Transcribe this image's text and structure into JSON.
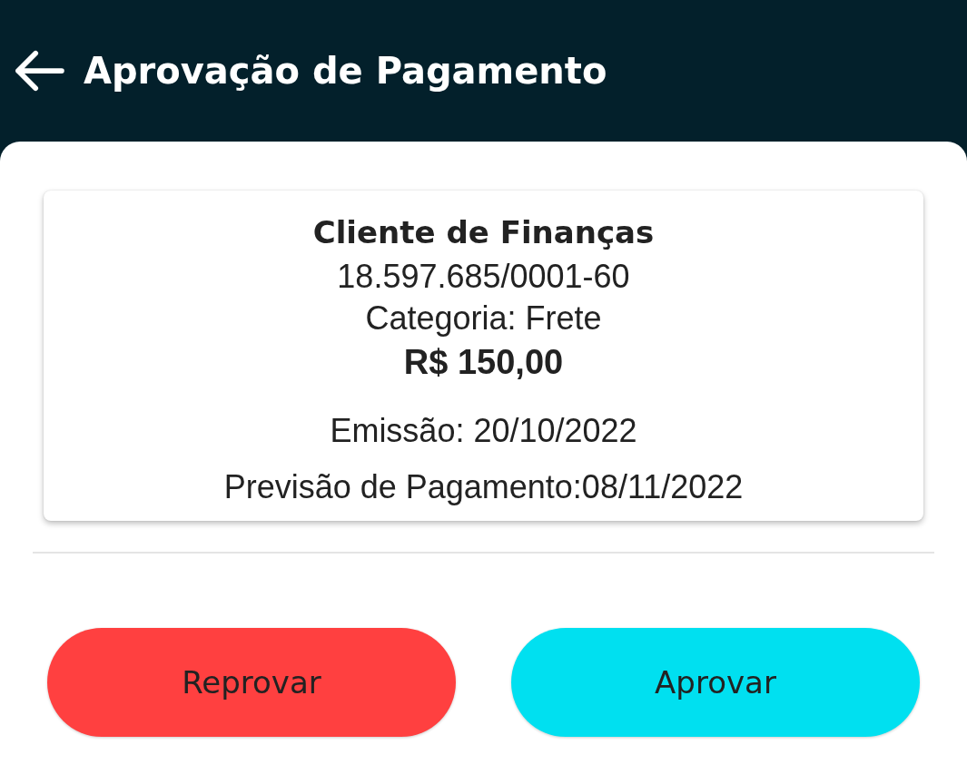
{
  "header": {
    "title": "Aprovação de Pagamento"
  },
  "card": {
    "client": "Cliente de Finanças",
    "document": "18.597.685/0001-60",
    "category": "Categoria: Frete",
    "amount": "R$ 150,00",
    "issue_date": "Emissão: 20/10/2022",
    "payment_forecast": "Previsão de Pagamento:08/11/2022"
  },
  "buttons": [
    {
      "label": "Reprovar",
      "kind": "reject"
    },
    {
      "label": "Aprovar",
      "kind": "approve"
    }
  ]
}
